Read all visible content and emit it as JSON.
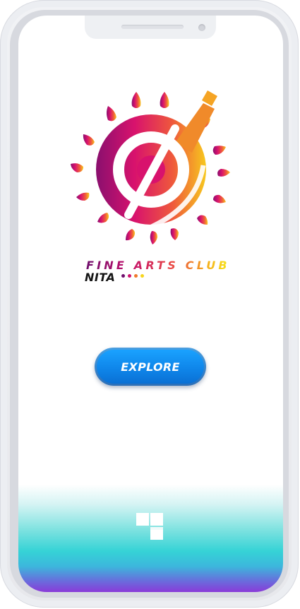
{
  "club": {
    "title": "FINE ARTS CLUB",
    "subtitle": "NITA"
  },
  "main": {
    "explore_label": "EXPLORE"
  },
  "colors": {
    "brand_purple": "#6f0e6c",
    "brand_magenta": "#d0126e",
    "brand_orange": "#f0782a",
    "brand_yellow": "#f7d51d",
    "button_blue": "#0f86ea",
    "footer_teal": "#35d3d6",
    "footer_violet": "#8a3ad8"
  },
  "icons": {
    "logo": "fine-arts-club-logo",
    "bottom": "tile-blocks-icon"
  }
}
